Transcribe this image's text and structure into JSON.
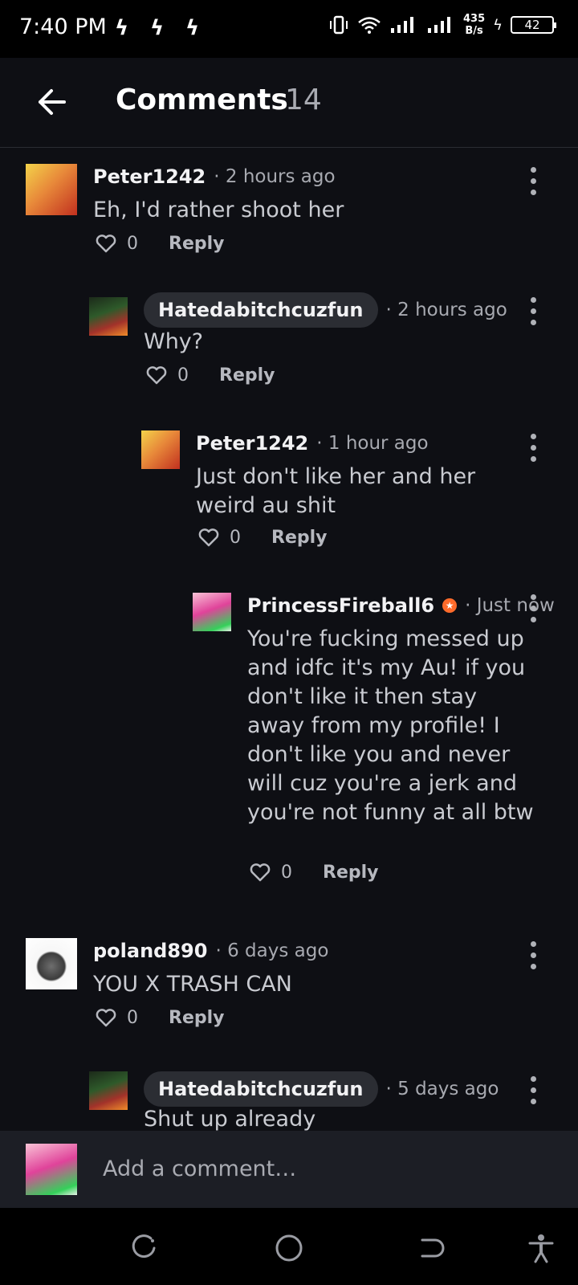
{
  "status_bar": {
    "time": "7:40 PM",
    "speed_value": "435",
    "speed_unit": "B/s",
    "battery": "42"
  },
  "header": {
    "title": "Comments",
    "count": "14"
  },
  "comments": [
    {
      "username": "Peter1242",
      "time": "· 2 hours ago",
      "text": "Eh, I'd rather shoot her",
      "likes": "0",
      "reply_label": "Reply"
    },
    {
      "username": "Hatedabitchcuzfun",
      "time": "· 2 hours ago",
      "text": "Why?",
      "likes": "0",
      "reply_label": "Reply"
    },
    {
      "username": "Peter1242",
      "time": "· 1 hour ago",
      "text": "Just don't like her and her weird au shit",
      "likes": "0",
      "reply_label": "Reply"
    },
    {
      "username": "PrincessFireball6",
      "time": "· Just now",
      "text": "You're fucking messed up and idfc it's my Au! if you don't like it then stay away from my profile! I don't like you and never will cuz you're a jerk and you're not funny at all btw",
      "likes": "0",
      "reply_label": "Reply"
    },
    {
      "username": "poland890",
      "time": "· 6 days ago",
      "text": "YOU X TRASH CAN",
      "likes": "0",
      "reply_label": "Reply"
    },
    {
      "username": "Hatedabitchcuzfun",
      "time": "· 5 days ago",
      "text": "Shut up already"
    }
  ],
  "composer": {
    "placeholder": "Add a comment…"
  },
  "icons": {
    "back": "arrow-left-icon",
    "like": "heart-outline-icon",
    "more": "kebab-menu-icon",
    "recents": "recents-icon",
    "home": "home-circle-icon",
    "back_nav": "back-nav-icon",
    "accessibility": "accessibility-icon"
  },
  "colors": {
    "background": "#0e0f14",
    "pill": "#2b2d33",
    "mod_badge": "#ff6b2b"
  }
}
